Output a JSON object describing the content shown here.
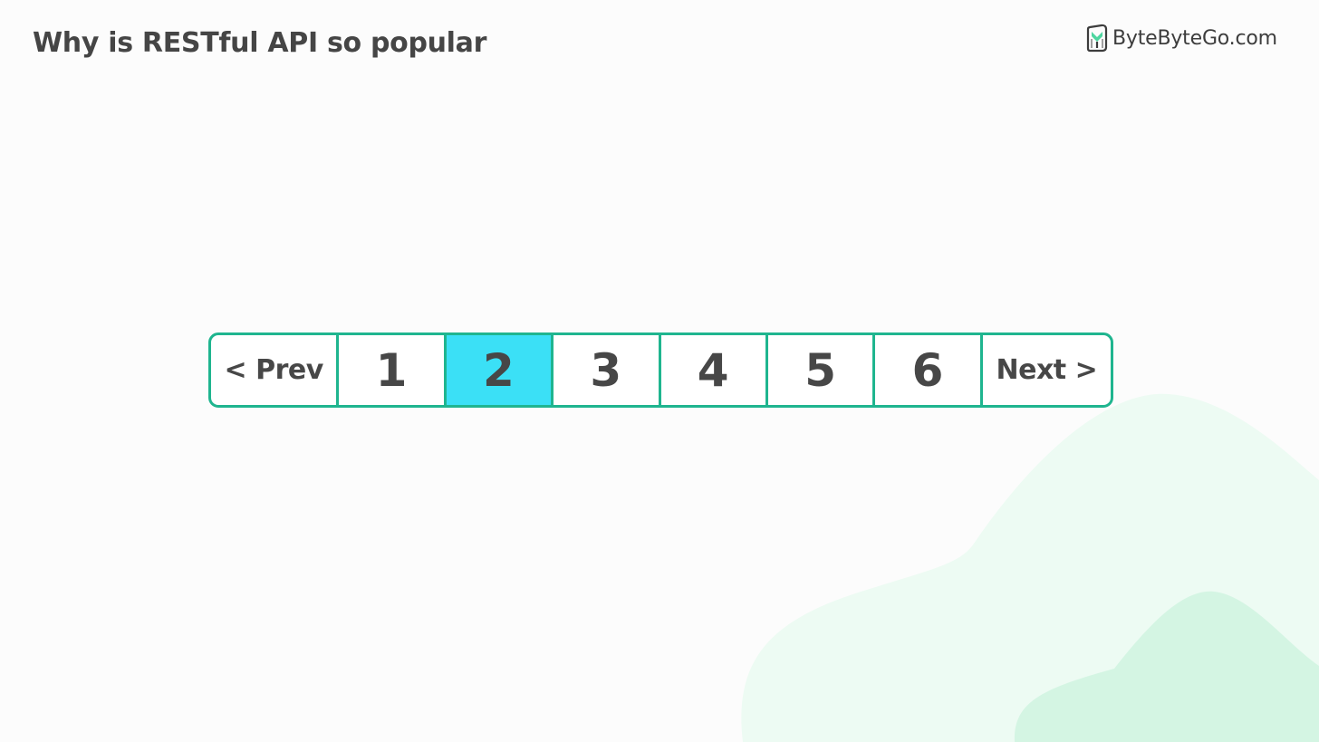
{
  "header": {
    "title": "Why is RESTful API so popular"
  },
  "brand": {
    "name": "ByteByteGo.com",
    "logo_icon": "bytebytego-logo-icon"
  },
  "pagination": {
    "prev_label": "< Prev",
    "next_label": "Next >",
    "pages": [
      "1",
      "2",
      "3",
      "4",
      "5",
      "6"
    ],
    "current_page": "2"
  },
  "colors": {
    "border": "#1fb58f",
    "active_background": "#3be0f6",
    "text": "#454545",
    "background": "#fcfcfc",
    "blob_light": "#edfbf3",
    "blob_mid": "#d4f5e3"
  }
}
